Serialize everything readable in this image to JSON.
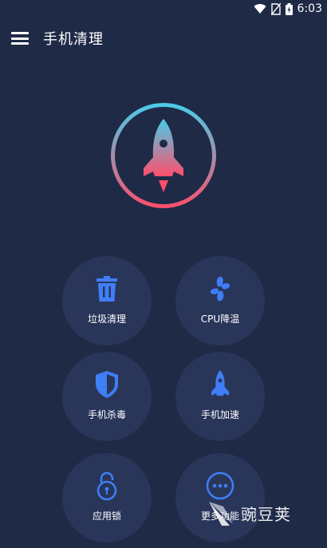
{
  "status_bar": {
    "time": "6:03",
    "icons": [
      "wifi-icon",
      "no-sim-icon",
      "battery-icon"
    ]
  },
  "app_bar": {
    "title": "手机清理",
    "menu_icon": "menu-icon"
  },
  "boost": {
    "icon": "rocket-icon",
    "gradient": [
      "#48cde9",
      "#ff4f6b"
    ]
  },
  "features": [
    {
      "label": "垃圾清理",
      "icon": "trash-icon"
    },
    {
      "label": "CPU降温",
      "icon": "fan-icon"
    },
    {
      "label": "手机杀毒",
      "icon": "shield-icon"
    },
    {
      "label": "手机加速",
      "icon": "rocket-icon"
    },
    {
      "label": "应用锁",
      "icon": "lock-icon"
    },
    {
      "label": "更多功能",
      "icon": "more-icon"
    }
  ],
  "watermark": {
    "text": "豌豆荚"
  },
  "colors": {
    "background": "#1f2a47",
    "tile": "#29365a",
    "icon_blue": "#3f7ef7"
  }
}
